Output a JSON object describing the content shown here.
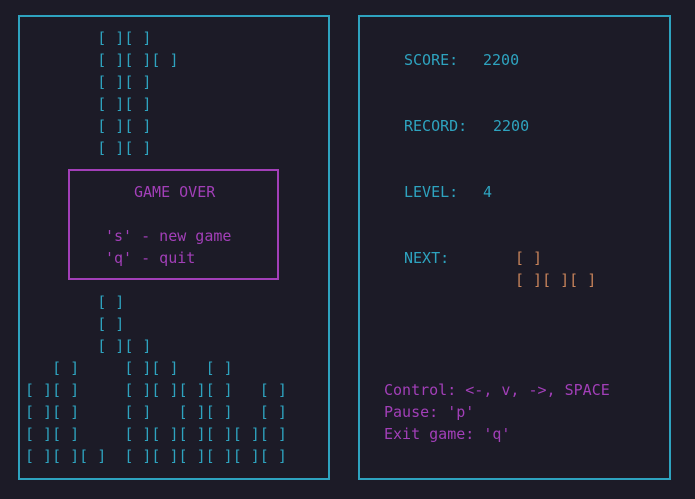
{
  "colors": {
    "background": "#1c1b27",
    "cyan": "#2ea3bf",
    "magenta": "#a23fb8",
    "orange": "#c7835a"
  },
  "board": {
    "rows": [
      "        [ ][ ]    ",
      "        [ ][ ][ ] ",
      "        [ ][ ]    ",
      "        [ ][ ]    ",
      "        [ ][ ]    ",
      "        [ ][ ]    ",
      "",
      "",
      "",
      "",
      "",
      "",
      "        [ ]       ",
      "        [ ]       ",
      "        [ ][ ]    ",
      "   [ ]     [ ][ ]   [ ]",
      "[ ][ ]     [ ][ ][ ][ ]   [ ]",
      "[ ][ ]     [ ]   [ ][ ]   [ ]",
      "[ ][ ]     [ ][ ][ ][ ][ ][ ]",
      "[ ][ ][ ]  [ ][ ][ ][ ][ ][ ]"
    ]
  },
  "game_over": {
    "title": "GAME OVER",
    "new_game": "'s' - new game",
    "quit": "'q' - quit"
  },
  "info": {
    "score_label": "SCORE:",
    "score_value": "2200",
    "record_label": "RECORD:",
    "record_value": "2200",
    "level_label": "LEVEL:",
    "level_value": "4",
    "next_label": "NEXT:",
    "next_rows": [
      "[ ]",
      "[ ][ ][ ]"
    ]
  },
  "help": {
    "control": "Control: <-, v, ->, SPACE",
    "pause": "Pause: 'p'",
    "exit": "Exit game: 'q'"
  }
}
